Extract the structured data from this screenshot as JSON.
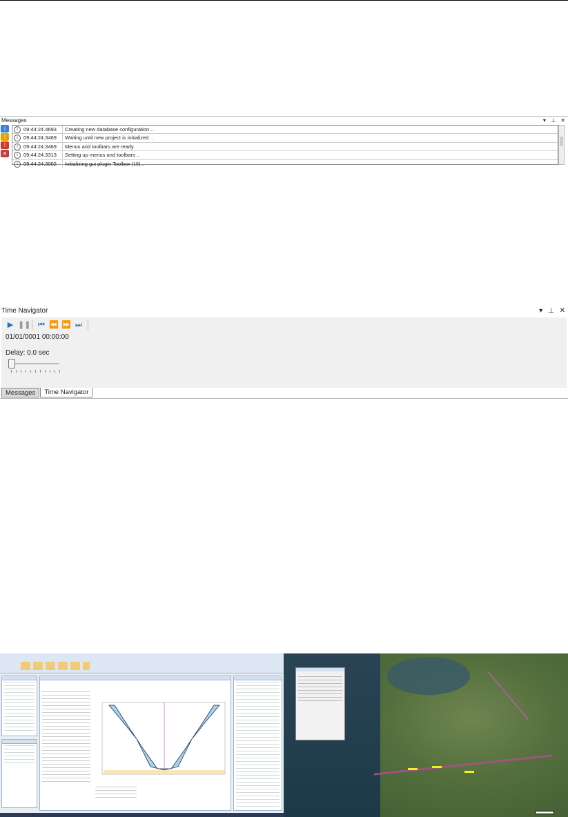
{
  "messages_panel": {
    "title": "Messages",
    "controls": [
      "▾",
      "⊥",
      "✕"
    ],
    "side_icons": [
      {
        "name": "info-filter-icon",
        "color": "#3a7fd5",
        "glyph": "i"
      },
      {
        "name": "warning-filter-icon",
        "color": "#e8a000",
        "glyph": "!"
      },
      {
        "name": "error-filter-icon",
        "color": "#d03a2a",
        "glyph": "!"
      },
      {
        "name": "clear-messages-icon",
        "color": "#c04040",
        "glyph": "✕"
      }
    ],
    "rows": [
      {
        "level": "i",
        "time": "09:44:24.4693",
        "text": "Creating new database configuration .."
      },
      {
        "level": "i",
        "time": "09:44:24.3469",
        "text": "Waiting until new project is initialized .."
      },
      {
        "level": "i",
        "time": "09:44:24.3469",
        "text": "Menus and toolbars are ready."
      },
      {
        "level": "i",
        "time": "09:44:24.3313",
        "text": "Setting up menus and toolbars .."
      },
      {
        "level": "i",
        "time": "09:44:24.3002",
        "text": "Initializing gui plugin Toolbox (UI) .."
      }
    ]
  },
  "time_navigator": {
    "title": "Time Navigator",
    "controls": [
      "▾",
      "⊥",
      "✕"
    ],
    "buttons": [
      {
        "name": "play-button",
        "glyph": "▶"
      },
      {
        "name": "pause-button",
        "glyph": "❚❚"
      },
      {
        "name": "first-frame-button",
        "glyph": "⏮"
      },
      {
        "name": "step-back-button",
        "glyph": "⏪"
      },
      {
        "name": "step-forward-button",
        "glyph": "⏩"
      },
      {
        "name": "last-frame-button",
        "glyph": "⏭"
      }
    ],
    "current_time": "01/01/0001 00:00:00",
    "delay_label": "Delay:",
    "delay_value": "0.0 sec",
    "slider_level": 0
  },
  "bottom_tabs": [
    "Messages",
    "Time Navigator"
  ],
  "colors": {
    "accent_blue": "#1e73be",
    "ribbon": "#dde6f3"
  }
}
